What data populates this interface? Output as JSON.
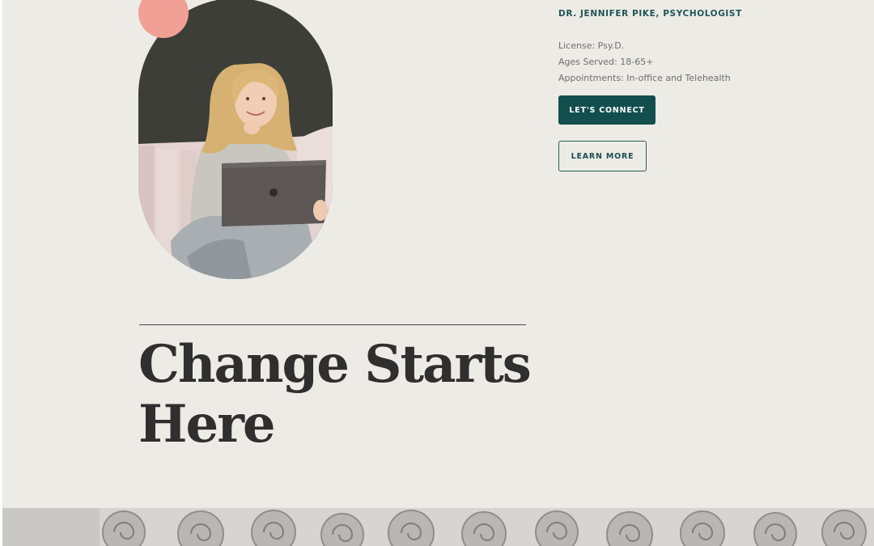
{
  "provider": {
    "name": "DR. JENNIFER PIKE, PSYCHOLOGIST",
    "details": [
      "License: Psy.D.",
      "Ages Served: 18-65+",
      "Appointments: In-office and Telehealth"
    ]
  },
  "buttons": {
    "connect_label": "LET'S CONNECT",
    "learn_label": "LEARN MORE"
  },
  "hero": {
    "headline_line1": "Change Starts",
    "headline_line2": "Here"
  },
  "colors": {
    "background": "#edebe6",
    "accent_teal": "#134e4e",
    "accent_coral": "#f0a094",
    "headline_text": "#2f2f2f"
  },
  "images": {
    "portrait": "woman-with-laptop-photo",
    "band": "stone-scroll-relief-photo"
  }
}
